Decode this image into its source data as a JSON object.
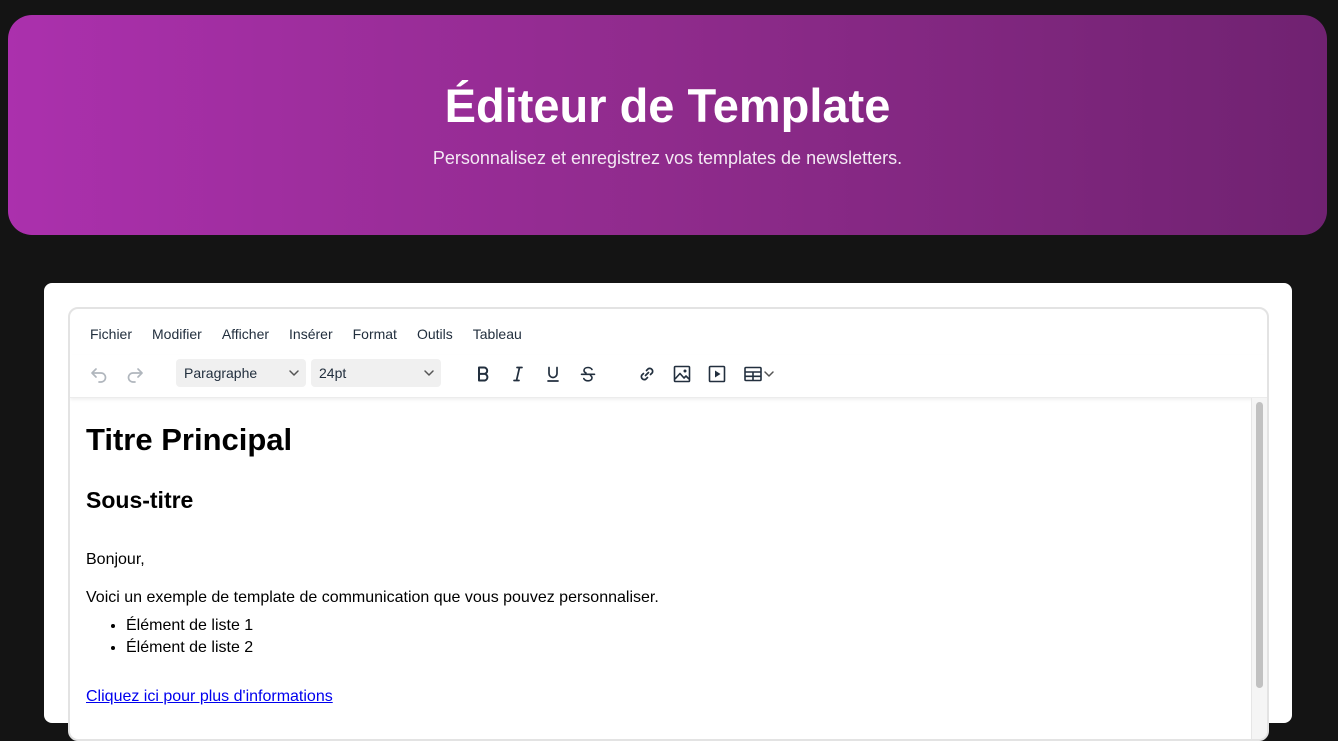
{
  "header": {
    "title": "Éditeur de Template",
    "subtitle": "Personnalisez et enregistrez vos templates de newsletters."
  },
  "editor": {
    "menu": [
      "Fichier",
      "Modifier",
      "Afficher",
      "Insérer",
      "Format",
      "Outils",
      "Tableau"
    ],
    "toolbar": {
      "block_format": "Paragraphe",
      "font_size": "24pt",
      "icons": [
        "undo-icon",
        "redo-icon",
        "bold-icon",
        "italic-icon",
        "underline-icon",
        "strikethrough-icon",
        "link-icon",
        "image-icon",
        "media-icon",
        "table-icon"
      ]
    },
    "content": {
      "heading1": "Titre Principal",
      "heading2": "Sous-titre",
      "greeting": "Bonjour,",
      "body": "Voici un exemple de template de communication que vous pouvez personnaliser.",
      "list_items": [
        "Élément de liste 1",
        "Élément de liste 2"
      ],
      "link_text": "Cliquez ici pour plus d'informations"
    }
  },
  "colors": {
    "gradient_start": "#ab30ad",
    "gradient_end": "#702271",
    "page_background": "#141414",
    "link": "#0000ee"
  }
}
